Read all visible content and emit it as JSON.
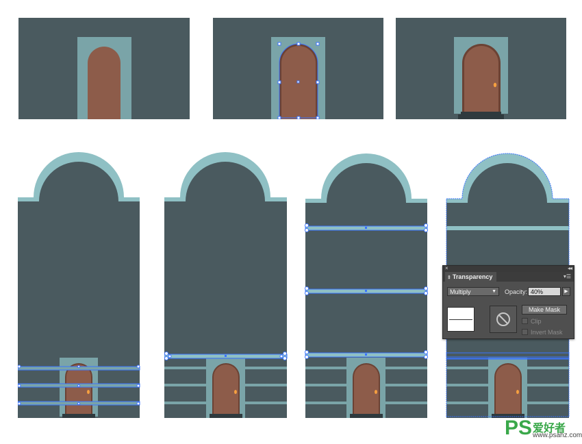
{
  "colors": {
    "wall": "#4a5a5f",
    "trim": "#7aa4a8",
    "arch_trim": "#8fc0c4",
    "door": "#8d5c4a",
    "door_dark": "#6b4234",
    "step": "#2f3a3e",
    "selection": "#3b74ff",
    "knob": "#f6a040"
  },
  "transparency_panel": {
    "tab_label": "Transparency",
    "blend_mode": "Multiply",
    "opacity_label": "Opacity:",
    "opacity_value": "40%",
    "make_mask_label": "Make Mask",
    "clip_label": "Clip",
    "invert_mask_label": "Invert Mask",
    "icons": [
      "double-arrow-icon",
      "panel-menu-icon",
      "chevron-down-icon",
      "triangle-right-icon",
      "no-mask-icon"
    ]
  },
  "watermark": {
    "brand": "PS",
    "cn_text": "爱好者",
    "url": "www.psahz.com"
  }
}
